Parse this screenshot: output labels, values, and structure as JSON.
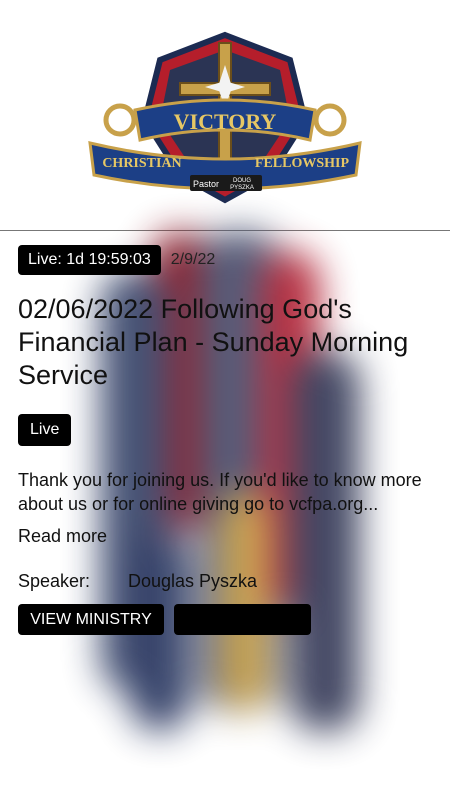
{
  "header": {
    "logo_icon": "victory-christian-fellowship-logo"
  },
  "event": {
    "live_chip": "Live: 1d 19:59:03",
    "date": "2/9/22",
    "title": "02/06/2022 Following God's Financial Plan - Sunday Morning Service",
    "badge": "Live",
    "description": "Thank you for joining us. If you'd like to know more about us or for online giving go to vcfpa.org...",
    "read_more": "Read more",
    "speaker_label": "Speaker:",
    "speaker_name": "Douglas Pyszka"
  },
  "actions": {
    "view_ministry": "VIEW MINISTRY",
    "second_button": ""
  },
  "colors": {
    "button_bg": "#000000",
    "text": "#111111"
  }
}
